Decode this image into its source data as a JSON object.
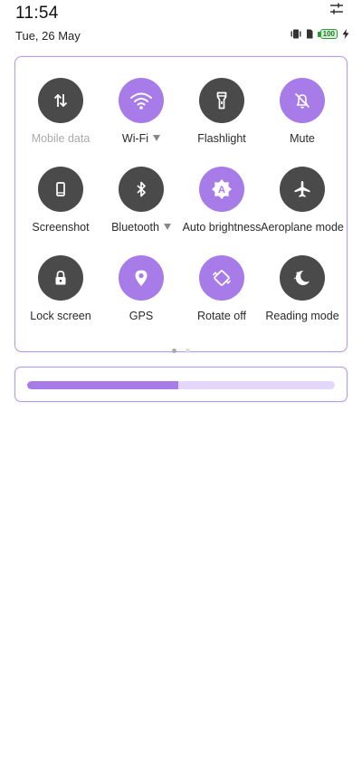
{
  "status": {
    "time": "11:54",
    "date": "Tue, 26 May",
    "battery_level": "100",
    "icons": [
      "settings-sliders-icon",
      "vibrate-icon",
      "battery-icon",
      "charging-bolt-icon"
    ]
  },
  "tiles": [
    {
      "label": "Mobile data",
      "icon": "mobile-data-arrows-icon",
      "active": false,
      "disabled": true
    },
    {
      "label": "Wi-Fi",
      "icon": "wifi-icon",
      "active": true,
      "has_menu": true
    },
    {
      "label": "Flashlight",
      "icon": "flashlight-icon",
      "active": false
    },
    {
      "label": "Mute",
      "icon": "mute-bell-icon",
      "active": true
    },
    {
      "label": "Screenshot",
      "icon": "screenshot-phone-icon",
      "active": false
    },
    {
      "label": "Bluetooth",
      "icon": "bluetooth-icon",
      "active": false,
      "has_menu": true
    },
    {
      "label": "Auto brightness",
      "icon": "auto-brightness-icon",
      "active": true
    },
    {
      "label": "Aeroplane mode",
      "icon": "aeroplane-icon",
      "active": false
    },
    {
      "label": "Lock screen",
      "icon": "lock-icon",
      "active": false
    },
    {
      "label": "GPS",
      "icon": "location-pin-icon",
      "active": true
    },
    {
      "label": "Rotate off",
      "icon": "rotate-icon",
      "active": true
    },
    {
      "label": "Reading mode",
      "icon": "moon-stars-icon",
      "active": false
    }
  ],
  "pager": {
    "pages": 2,
    "current": 1
  },
  "brightness": {
    "level_percent": 49
  },
  "colors": {
    "accent": "#a77be8",
    "accent_light": "#e5d6fb",
    "tile_off": "#4a4a4a",
    "border": "#b69ce6"
  }
}
